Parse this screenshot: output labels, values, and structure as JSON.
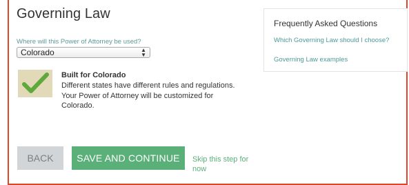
{
  "page": {
    "title": "Governing Law",
    "question_label": "Where will this Power of Attorney be used?",
    "state_select": {
      "value": "Colorado"
    }
  },
  "info": {
    "title": "Built for Colorado",
    "description": "Different states have different rules and regulations. Your Power of Attorney will be customized for Colorado."
  },
  "faq": {
    "title": "Frequently Asked Questions",
    "links": [
      "Which Governing Law should I choose?",
      "Governing Law examples"
    ]
  },
  "actions": {
    "back": "BACK",
    "save_continue": "SAVE AND CONTINUE",
    "skip": "Skip this step for now"
  },
  "colors": {
    "border_accent": "#e0442a",
    "primary_button": "#5bb07a",
    "link": "#4d9a9a",
    "back_button": "#d2d5d7"
  },
  "icons": {
    "check": "checkmark-icon"
  }
}
